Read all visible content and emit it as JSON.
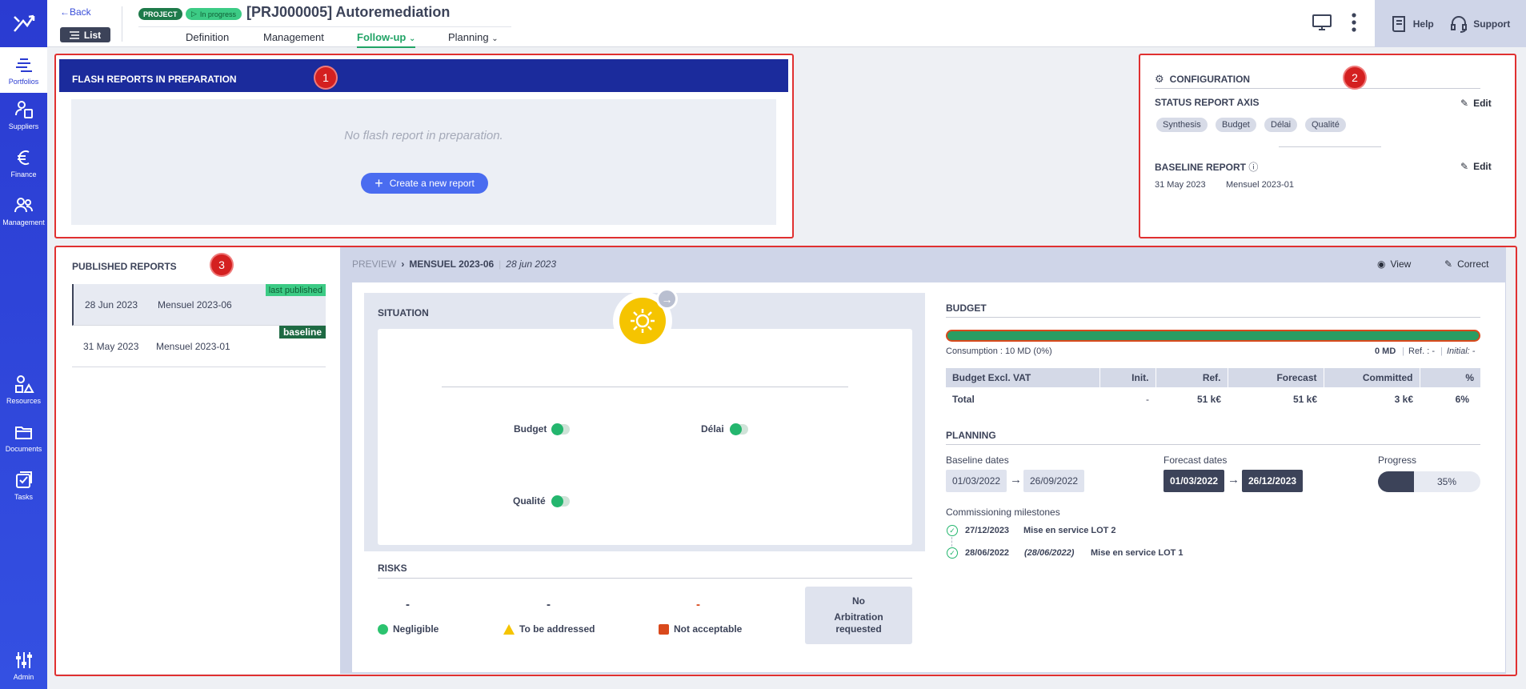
{
  "header": {
    "back_label": "Back",
    "list_label": "List",
    "badge_project": "PROJECT",
    "badge_status": "In progress",
    "project_title": "[PRJ000005] Autoremediation",
    "tabs": [
      "Definition",
      "Management",
      "Follow-up",
      "Planning"
    ],
    "active_tab": "Follow-up",
    "help_label": "Help",
    "support_label": "Support"
  },
  "rail": {
    "items": [
      "Portfolios",
      "Suppliers",
      "Finance",
      "Management",
      "Resources",
      "Documents",
      "Tasks",
      "Admin"
    ],
    "active": "Portfolios"
  },
  "annotations": [
    "1",
    "2",
    "3"
  ],
  "flash": {
    "title": "FLASH REPORTS IN PREPARATION",
    "empty_text": "No flash report in preparation.",
    "create_label": "Create a new report"
  },
  "config": {
    "title": "CONFIGURATION",
    "axis_label": "STATUS REPORT AXIS",
    "axis_chips": [
      "Synthesis",
      "Budget",
      "Délai",
      "Qualité"
    ],
    "edit_label": "Edit",
    "baseline_label": "BASELINE REPORT",
    "baseline_date": "31 May 2023",
    "baseline_name": "Mensuel 2023-01"
  },
  "published": {
    "title": "PUBLISHED REPORTS",
    "rows": [
      {
        "date": "28 Jun 2023",
        "name": "Mensuel 2023-06",
        "tag": "last published"
      },
      {
        "date": "31 May 2023",
        "name": "Mensuel 2023-01",
        "tag": "baseline"
      }
    ]
  },
  "preview": {
    "prefix": "PREVIEW",
    "report_name": "MENSUEL 2023-06",
    "report_date": "28 jun 2023",
    "view_label": "View",
    "correct_label": "Correct"
  },
  "situation": {
    "title": "SITUATION",
    "axes": [
      "Budget",
      "Délai",
      "Qualité"
    ],
    "status_color": "#f5c400"
  },
  "risks": {
    "title": "RISKS",
    "items": [
      {
        "value": "-",
        "label": "Negligible",
        "color": "#2cc36f"
      },
      {
        "value": "-",
        "label": "To be addressed",
        "color": "#f5c400"
      },
      {
        "value": "-",
        "label": "Not acceptable",
        "color": "#d9491c"
      }
    ],
    "arbitration": {
      "line1": "No",
      "line2": "Arbitration",
      "line3": "requested"
    }
  },
  "budget": {
    "title": "BUDGET",
    "consumption": "Consumption : 10 MD (0%)",
    "md": "0 MD",
    "ref": "Ref. : -",
    "initial": "Initial: -",
    "consumption_ratio": 0,
    "columns": [
      "Budget Excl. VAT",
      "Init.",
      "Ref.",
      "Forecast",
      "Committed",
      "%"
    ],
    "rows": [
      {
        "label": "Total",
        "init": "-",
        "ref": "51 k€",
        "forecast": "51 k€",
        "committed": "3 k€",
        "pct": "6%"
      }
    ]
  },
  "planning": {
    "title": "PLANNING",
    "baseline_label": "Baseline dates",
    "baseline_start": "01/03/2022",
    "baseline_end": "26/09/2022",
    "forecast_label": "Forecast dates",
    "forecast_start": "01/03/2022",
    "forecast_end": "26/12/2023",
    "progress_label": "Progress",
    "progress_text": "35%",
    "progress_ratio": 0.35,
    "milestones_label": "Commissioning milestones",
    "milestones": [
      {
        "date": "27/12/2023",
        "prev": "",
        "name": "Mise en service LOT 2"
      },
      {
        "date": "28/06/2022",
        "prev": "(28/06/2022)",
        "name": "Mise en service LOT 1"
      }
    ]
  }
}
